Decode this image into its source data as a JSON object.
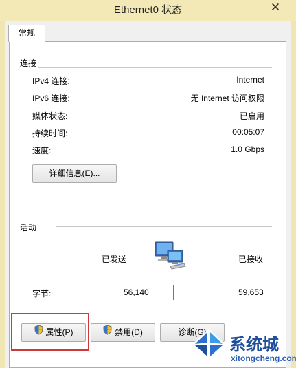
{
  "window": {
    "title": "Ethernet0 状态",
    "close_glyph": "✕"
  },
  "tabs": [
    {
      "label": "常规"
    }
  ],
  "connection": {
    "title": "连接",
    "rows": [
      {
        "label": "IPv4 连接:",
        "value": "Internet"
      },
      {
        "label": "IPv6 连接:",
        "value": "无 Internet 访问权限"
      },
      {
        "label": "媒体状态:",
        "value": "已启用"
      },
      {
        "label": "持续时间:",
        "value": "00:05:07"
      },
      {
        "label": "速度:",
        "value": "1.0 Gbps"
      }
    ],
    "details_button": "详细信息(E)..."
  },
  "activity": {
    "title": "活动",
    "sent_label": "已发送",
    "received_label": "已接收",
    "bytes_label": "字节:",
    "bytes_sent": "56,140",
    "bytes_received": "59,653",
    "icon": "network-computers-icon"
  },
  "buttons": {
    "properties": "属性(P)",
    "disable": "禁用(D)",
    "diagnose": "诊断(G)"
  },
  "watermark": {
    "text": "系统城",
    "url": "xitongcheng.com"
  },
  "colors": {
    "frame": "#f3e9b6",
    "highlight": "#cc3a3a",
    "watermark": "#1f4e9c"
  }
}
